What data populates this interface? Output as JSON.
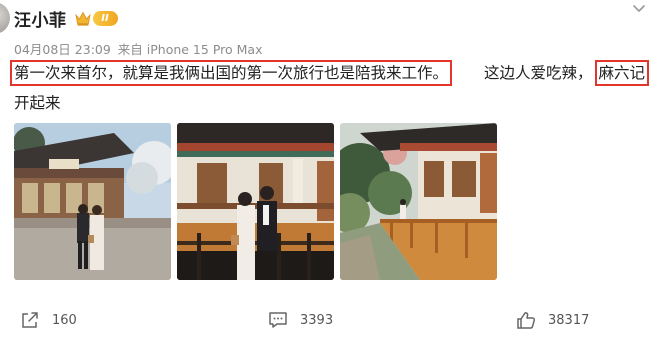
{
  "post": {
    "author": "汪小菲",
    "vip_level": "II",
    "date": "04月08日 23:09",
    "source": "来自 iPhone 15 Pro Max",
    "text_segment_1": "第一次来首尔，就算是我俩出国的第一次旅行也是陪我来工作。",
    "text_segment_2": "这边人爱吃辣，",
    "text_segment_3": "麻六记",
    "text_segment_4": "开起来"
  },
  "photos": [
    {
      "name": "couple-at-hanok-courtyard"
    },
    {
      "name": "couple-on-hanok-terrace"
    },
    {
      "name": "hanok-garden-veranda"
    }
  ],
  "actions": {
    "reposts": "160",
    "comments": "3393",
    "likes": "38317"
  },
  "icons": [
    "more-icon",
    "crown-icon",
    "repost-icon",
    "comment-icon",
    "like-icon"
  ],
  "colors": {
    "highlight_box": "#e2352b",
    "vip_gold": "#f0a623",
    "meta_gray": "#8c8c8c"
  }
}
